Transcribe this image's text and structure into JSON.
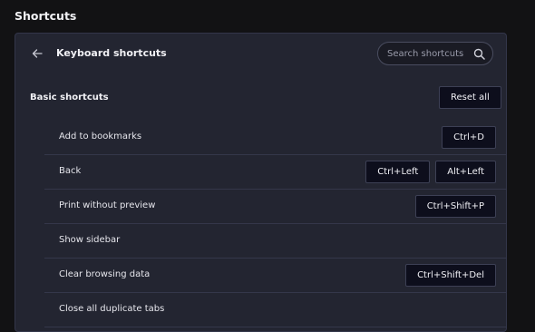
{
  "page": {
    "title": "Shortcuts"
  },
  "panel": {
    "title": "Keyboard shortcuts",
    "back_icon": "arrow-left-icon",
    "search": {
      "placeholder": "Search shortcuts",
      "value": "",
      "icon": "search-icon"
    }
  },
  "section": {
    "title": "Basic shortcuts",
    "reset_label": "Reset all"
  },
  "shortcuts": [
    {
      "label": "Add to bookmarks",
      "keys": [
        "Ctrl+D"
      ]
    },
    {
      "label": "Back",
      "keys": [
        "Ctrl+Left",
        "Alt+Left"
      ]
    },
    {
      "label": "Print without preview",
      "keys": [
        "Ctrl+Shift+P"
      ]
    },
    {
      "label": "Show sidebar",
      "keys": []
    },
    {
      "label": "Clear browsing data",
      "keys": [
        "Ctrl+Shift+Del"
      ]
    },
    {
      "label": "Close all duplicate tabs",
      "keys": []
    }
  ],
  "colors": {
    "background": "#121214",
    "panel": "#232531",
    "key_button": "#0d0e1c"
  }
}
